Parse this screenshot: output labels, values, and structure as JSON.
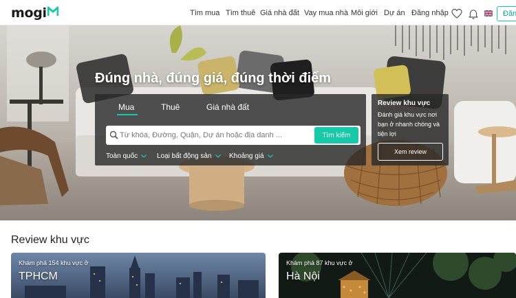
{
  "header": {
    "logo_text": "mogi",
    "nav": [
      "Tìm mua",
      "Tìm thuê",
      "Giá nhà đất",
      "Vay mua nhà",
      "Môi giới",
      "Dự án",
      "Đăng nhập"
    ],
    "lang_label": "Đăng"
  },
  "hero": {
    "title": "Đúng nhà, đúng giá, đúng thời điểm"
  },
  "search": {
    "tabs": [
      "Mua",
      "Thuê",
      "Giá nhà đất"
    ],
    "active_tab": "Mua",
    "placeholder": "Từ khóa, Đường, Quận, Dự án hoặc địa danh ...",
    "value": "",
    "button_label": "Tìm kiếm",
    "filters": [
      "Toàn quốc",
      "Loại bất động sản",
      "Khoảng giá"
    ]
  },
  "review_panel": {
    "title": "Review khu vực",
    "description": "Đánh giá khu vực nơi bạn ở nhanh chóng và tiện lợi",
    "button_label": "Xem review"
  },
  "review_section": {
    "title": "Review khu vực",
    "cards": [
      {
        "subtitle": "Khám phá 154 khu vực ở",
        "city": "TPHCM"
      },
      {
        "subtitle": "Khám phá 87 khu vực ở",
        "city": "Hà Nội"
      }
    ]
  },
  "colors": {
    "accent": "#16c9a8",
    "panel_bg": "rgba(40,40,40,0.8)"
  }
}
